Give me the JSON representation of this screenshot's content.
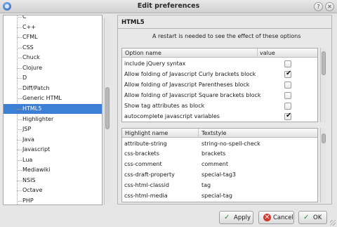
{
  "window": {
    "title": "Edit preferences",
    "help_glyph": "?",
    "close_glyph": "✕"
  },
  "languages": [
    "C",
    "C++",
    "CFML",
    "CSS",
    "Chuck",
    "Clojure",
    "D",
    "Diff/Patch",
    "Generic HTML",
    "HTML5",
    "Highlighter",
    "JSP",
    "Java",
    "Javascript",
    "Lua",
    "Mediawiki",
    "NSIS",
    "Octave",
    "PHP"
  ],
  "selected_language": "HTML5",
  "section": {
    "title": "HTML5",
    "restart_note": "A restart is needed to see the effect of these options"
  },
  "options_table": {
    "col_name": "Option name",
    "col_value": "value",
    "rows": [
      {
        "name": "include jQuery syntax",
        "checked": false
      },
      {
        "name": "Allow folding of Javascript Curly brackets block",
        "checked": true
      },
      {
        "name": "Allow folding of Javascript Parentheses block",
        "checked": false
      },
      {
        "name": "Allow folding of Javascript Square brackets block",
        "checked": false
      },
      {
        "name": "Show tag attributes as block",
        "checked": false
      },
      {
        "name": "autocomplete javascript variables",
        "checked": true
      }
    ]
  },
  "highlight_table": {
    "col_name": "Highlight name",
    "col_style": "Textstyle",
    "rows": [
      {
        "name": "attribute-string",
        "style": "string-no-spell-check"
      },
      {
        "name": "css-brackets",
        "style": "brackets"
      },
      {
        "name": "css-comment",
        "style": "comment"
      },
      {
        "name": "css-draft-property",
        "style": "special-tag3"
      },
      {
        "name": "css-html-classid",
        "style": "tag"
      },
      {
        "name": "css-html-media",
        "style": "special-tag"
      }
    ]
  },
  "buttons": {
    "apply": "Apply",
    "cancel": "Cancel",
    "ok": "OK",
    "apply_icon": "✓",
    "cancel_icon": "✕",
    "ok_icon": "✓"
  },
  "check_glyph": "✔"
}
